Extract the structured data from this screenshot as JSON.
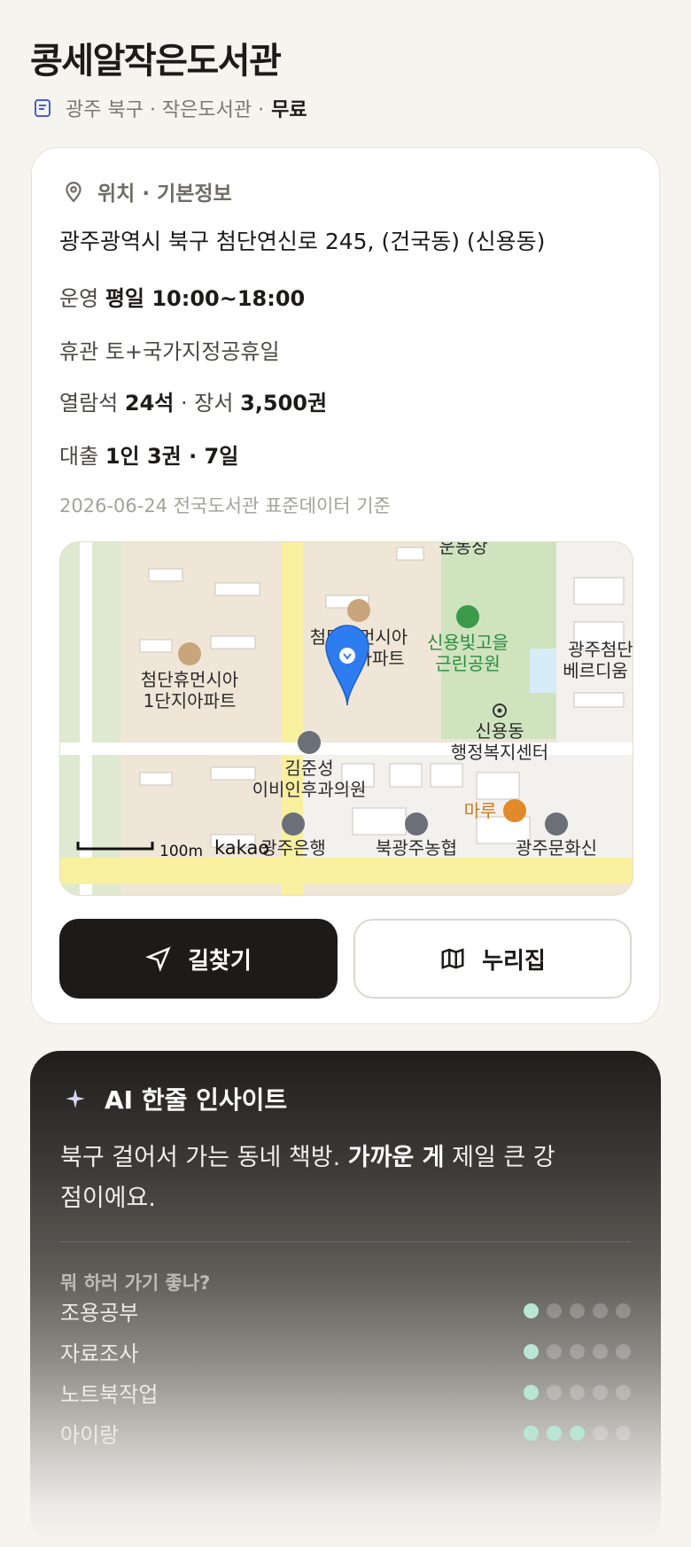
{
  "title": "콩세알작은도서관",
  "meta": {
    "region_type": "광주 북구 · 작은도서관 ·",
    "fee": "무료"
  },
  "info": {
    "section_title": "위치 · 기본정보",
    "address": "광주광역시 북구 첨단연신로 245, (건국동) (신용동)",
    "hours_label": "운영",
    "hours_value": "평일 10:00~18:00",
    "closed_label": "휴관",
    "closed_value": "토+국가지정공휴일",
    "seats_label": "열람석",
    "seats_value": "24석",
    "books_label": "· 장서",
    "books_value": "3,500권",
    "loan_label": "대출",
    "loan_value": "1인 3권 · 7일",
    "source": "2026-06-24 전국도서관 표준데이터 기준"
  },
  "map": {
    "labels": {
      "top_cut": "운동장",
      "apt_left_1": "첨단휴먼시아",
      "apt_left_2": "1단지아파트",
      "apt_mid_1": "첨단휴먼시아",
      "apt_mid_2": "지아파트",
      "park_1": "신용빛고을",
      "park_2": "근린공원",
      "right_1": "광주첨단",
      "right_2": "베르디움",
      "admin_1": "신용동",
      "admin_2": "행정복지센터",
      "clinic_1": "김준성",
      "clinic_2": "이비인후과의원",
      "restaurant": "마루",
      "bank_1": "광주은행",
      "bank_2": "북광주농협",
      "culture": "광주문화신",
      "scale": "100m",
      "brand": "kakao"
    }
  },
  "buttons": {
    "route": "길찾기",
    "nuri": "누리집"
  },
  "ai": {
    "title": "AI 한줄 인사이트",
    "body_pre": "북구 걸어서 가는 동네 책방. ",
    "body_bold": "가까운 게",
    "body_post": " 제일 큰 강점이에요.",
    "question": "뭐 하러 가기 좋나?",
    "rows": [
      {
        "name": "조용공부",
        "score": 1
      },
      {
        "name": "자료조사",
        "score": 1
      },
      {
        "name": "노트북작업",
        "score": 1
      },
      {
        "name": "아이랑",
        "score": 3
      }
    ]
  },
  "colors": {
    "accent_dot": "#b9e6d4",
    "dark": "#1c1b19",
    "pin": "#2e7df0"
  }
}
